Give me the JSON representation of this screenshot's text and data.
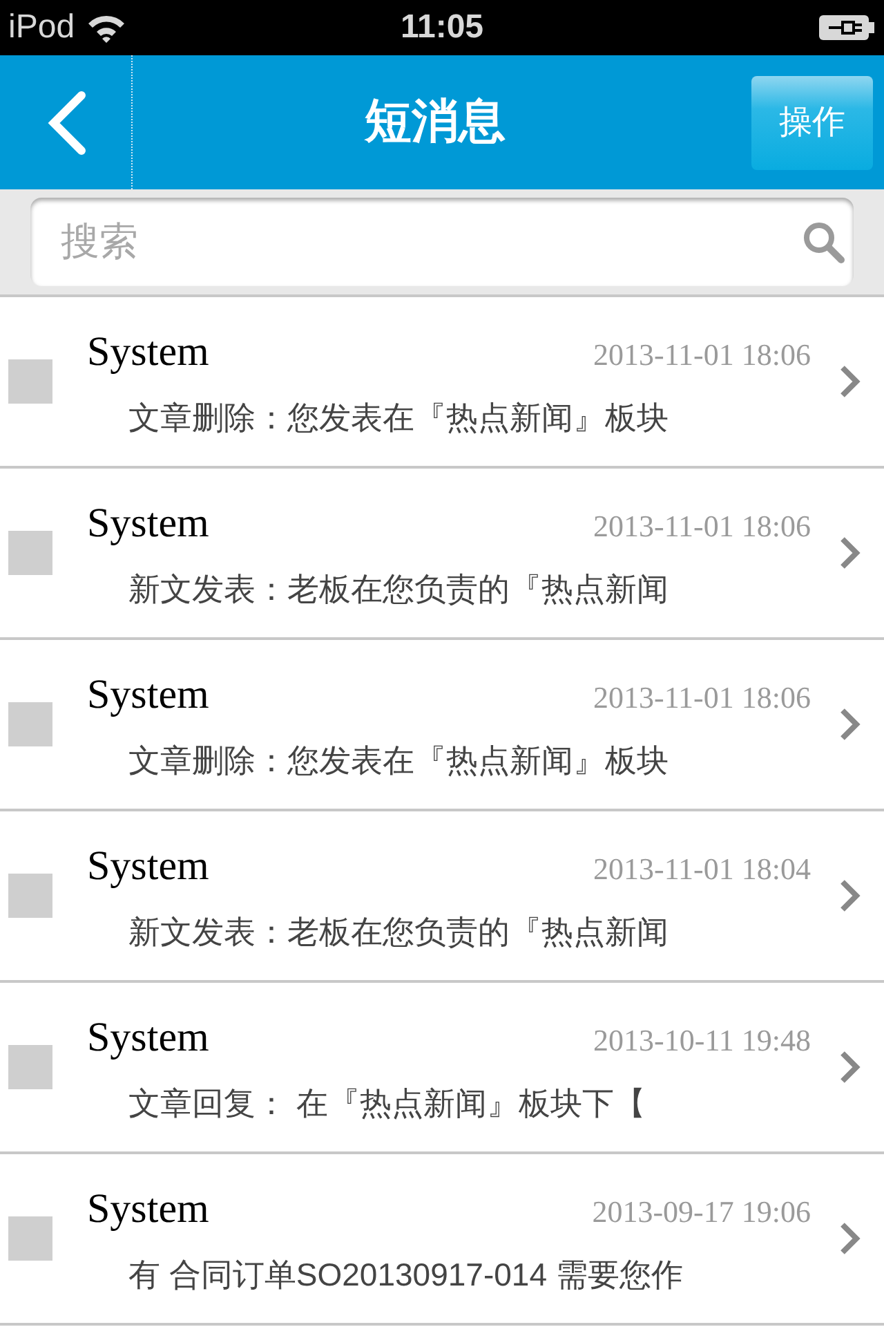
{
  "status_bar": {
    "device": "iPod",
    "time": "11:05"
  },
  "nav_bar": {
    "title": "短消息",
    "action_button": "操作"
  },
  "search": {
    "placeholder": "搜索"
  },
  "messages": [
    {
      "sender": "System",
      "time": "2013-11-01 18:06",
      "preview": "文章删除：您发表在『热点新闻』板块",
      "checked": false
    },
    {
      "sender": "System",
      "time": "2013-11-01 18:06",
      "preview": "新文发表：老板在您负责的『热点新闻",
      "checked": false
    },
    {
      "sender": "System",
      "time": "2013-11-01 18:06",
      "preview": "文章删除：您发表在『热点新闻』板块",
      "checked": false
    },
    {
      "sender": "System",
      "time": "2013-11-01 18:04",
      "preview": "新文发表：老板在您负责的『热点新闻",
      "checked": false
    },
    {
      "sender": "System",
      "time": "2013-10-11 19:48",
      "preview": "文章回复： 在『热点新闻』板块下【",
      "checked": false
    },
    {
      "sender": "System",
      "time": "2013-09-17 19:06",
      "preview": "有 合同订单SO20130917-014 需要您作",
      "checked": false
    }
  ]
}
